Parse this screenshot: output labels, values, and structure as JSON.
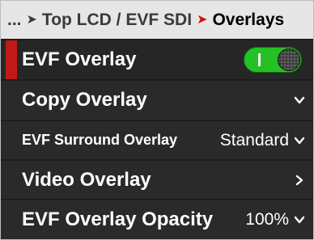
{
  "breadcrumb": {
    "ellipsis": "...",
    "parent": "Top LCD / EVF SDI",
    "current": "Overlays"
  },
  "menu": [
    {
      "label": "EVF Overlay",
      "control": "toggle",
      "toggle_state": "on"
    },
    {
      "label": "Copy Overlay",
      "control": "chevron-down"
    },
    {
      "label": "EVF Surround Overlay",
      "value": "Standard",
      "control": "chevron-down"
    },
    {
      "label": "Video Overlay",
      "control": "chevron-right"
    },
    {
      "label": "EVF Overlay Opacity",
      "value": "100%",
      "control": "chevron-down"
    }
  ],
  "colors": {
    "selection_bar": "#c11919",
    "toggle_on": "#25c025",
    "breadcrumb_arrow_current": "#cc1212"
  }
}
